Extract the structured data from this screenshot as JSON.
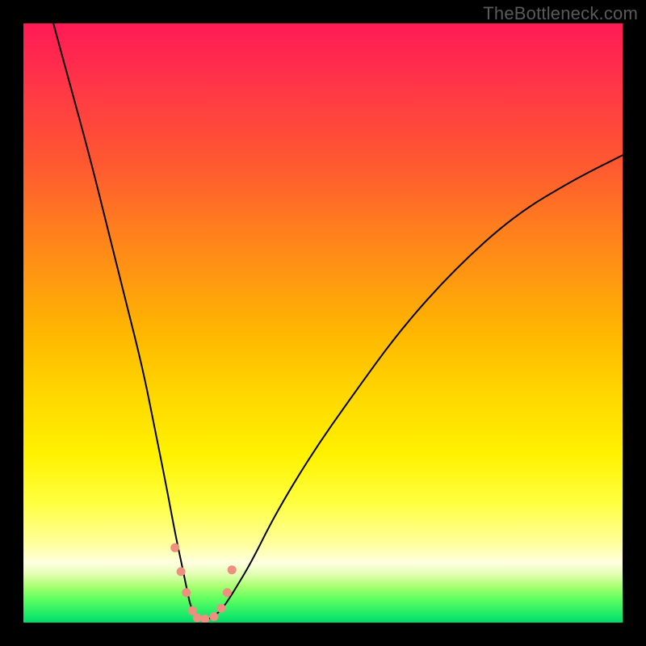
{
  "watermark": "TheBottleneck.com",
  "chart_data": {
    "type": "line",
    "title": "",
    "xlabel": "",
    "ylabel": "",
    "xlim": [
      0,
      100
    ],
    "ylim": [
      0,
      100
    ],
    "grid": false,
    "legend": false,
    "background_gradient": {
      "top": "#ff1a55",
      "upper_mid": "#ff9a10",
      "mid": "#ffe600",
      "lower_mid": "#ffffc0",
      "bottom": "#15e86a"
    },
    "series": [
      {
        "name": "bottleneck-curve",
        "color": "#000000",
        "stroke_width": 2,
        "x": [
          5,
          8,
          11,
          14,
          17,
          20,
          22,
          24,
          25.5,
          27,
          28,
          29.5,
          31,
          33,
          35,
          38,
          42,
          48,
          55,
          63,
          72,
          82,
          92,
          100
        ],
        "y": [
          100,
          89,
          78,
          66,
          54,
          42,
          32,
          22,
          14,
          7,
          2,
          0.5,
          0.5,
          2,
          5,
          10,
          18,
          28,
          38,
          49,
          59,
          68,
          74,
          78
        ]
      },
      {
        "name": "marker-dots",
        "color": "#ef8f80",
        "type": "scatter",
        "marker_size": 11,
        "x": [
          25.3,
          26.3,
          27.2,
          28.2,
          29.0,
          30.3,
          31.8,
          33.0,
          34.0,
          34.8
        ],
        "y": [
          12.5,
          8.5,
          5.0,
          2.0,
          0.8,
          0.6,
          1.0,
          2.4,
          5.0,
          8.8
        ]
      }
    ]
  }
}
